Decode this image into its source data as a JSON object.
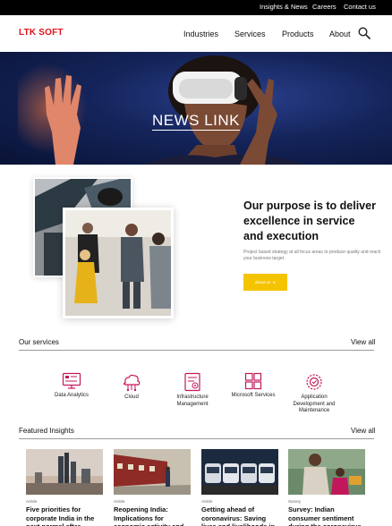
{
  "topbar": {
    "links": [
      "Insights & News",
      "Careers",
      "Contact us"
    ]
  },
  "header": {
    "logo": "LTK SOFT",
    "nav": [
      "Industries",
      "Services",
      "Products",
      "About"
    ],
    "search_icon": "search-icon"
  },
  "hero": {
    "title": "NEWS LINK"
  },
  "purpose": {
    "title": "Our purpose is to deliver excellence in service and execution",
    "description": "Project based strategy at all focus areas to produce quality and reach your business target.",
    "button_label": "about us"
  },
  "services": {
    "title": "Our services",
    "view_all": "View all",
    "items": [
      {
        "label": "Data Analytics",
        "icon": "data-analytics-icon"
      },
      {
        "label": "Cloud",
        "icon": "cloud-icon"
      },
      {
        "label": "Infrastructure Management",
        "icon": "infrastructure-icon"
      },
      {
        "label": "Microsoft Services",
        "icon": "microsoft-icon"
      },
      {
        "label": "Application Development and Maintenance",
        "icon": "application-development-icon"
      }
    ]
  },
  "insights": {
    "title": "Featured Insights",
    "view_all": "View all",
    "cards": [
      {
        "type": "Article",
        "title": "Five priorities for corporate India in the next normal after"
      },
      {
        "type": "Article",
        "title": "Reopening India: Implications for economic activity and"
      },
      {
        "type": "Article",
        "title": "Getting ahead of coronavirus: Saving lives and livelihoods in"
      },
      {
        "type": "Survey",
        "title": "Survey: Indian consumer sentiment during the coronavirus"
      }
    ]
  },
  "colors": {
    "brand_red": "#e0121b",
    "accent_yellow": "#f5c400",
    "icon_pink": "#c2185b"
  }
}
